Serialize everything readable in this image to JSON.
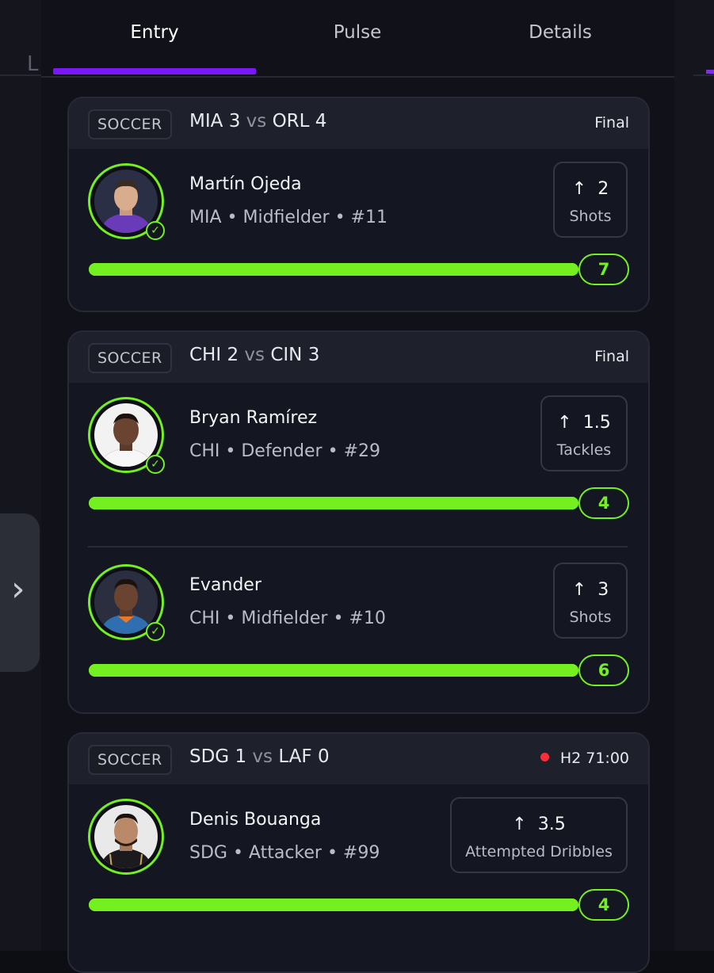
{
  "tabs": [
    {
      "label": "Entry",
      "active": true
    },
    {
      "label": "Pulse",
      "active": false
    },
    {
      "label": "Details",
      "active": false
    }
  ],
  "colors": {
    "accent_purple": "#7a18f5",
    "progress_green": "#74f021",
    "live_red": "#ff2d3a"
  },
  "side_handle_icon": "chevron-right-icon",
  "cards": [
    {
      "sport": "SOCCER",
      "home_team": "MIA",
      "home_score": "3",
      "vs": "vs",
      "away_team": "ORL",
      "away_score": "4",
      "status": "Final",
      "live": false,
      "players": [
        {
          "name": "Martín Ojeda",
          "meta": "MIA • Midfielder • #11",
          "stat_value": "2",
          "stat_label": "Shots",
          "direction_icon": "arrow-up-icon",
          "progress": 1.0,
          "result": "7",
          "check_icon": "check-circle-icon"
        }
      ]
    },
    {
      "sport": "SOCCER",
      "home_team": "CHI",
      "home_score": "2",
      "vs": "vs",
      "away_team": "CIN",
      "away_score": "3",
      "status": "Final",
      "live": false,
      "players": [
        {
          "name": "Bryan Ramírez",
          "meta": "CHI • Defender • #29",
          "stat_value": "1.5",
          "stat_label": "Tackles",
          "direction_icon": "arrow-up-icon",
          "progress": 1.0,
          "result": "4",
          "check_icon": "check-circle-icon"
        },
        {
          "name": "Evander",
          "meta": "CHI • Midfielder • #10",
          "stat_value": "3",
          "stat_label": "Shots",
          "direction_icon": "arrow-up-icon",
          "progress": 1.0,
          "result": "6",
          "check_icon": "check-circle-icon"
        }
      ]
    },
    {
      "sport": "SOCCER",
      "home_team": "SDG",
      "home_score": "1",
      "vs": "vs",
      "away_team": "LAF",
      "away_score": "0",
      "status": "H2 71:00",
      "live": true,
      "players": [
        {
          "name": "Denis Bouanga",
          "meta": "SDG • Attacker • #99",
          "stat_value": "3.5",
          "stat_label": "Attempted Dribbles",
          "direction_icon": "arrow-up-icon",
          "progress": 1.0,
          "result": "4",
          "check_icon": ""
        }
      ]
    }
  ]
}
